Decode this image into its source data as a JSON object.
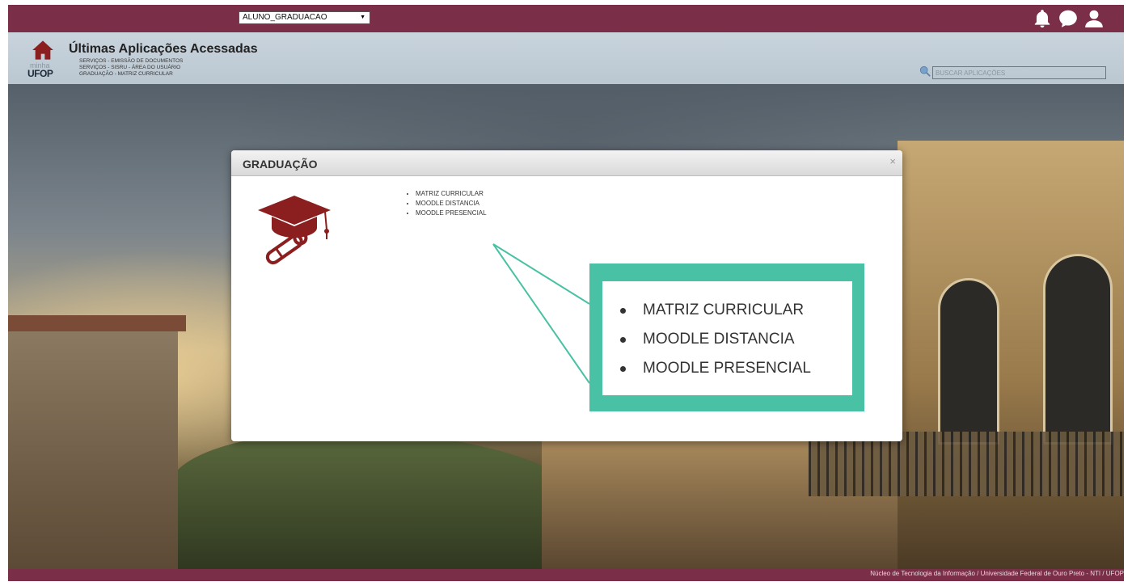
{
  "topbar": {
    "profile_select": {
      "selected": "ALUNO_GRADUACAO",
      "caret": "▼"
    },
    "icons": [
      "bell-icon",
      "chat-icon",
      "user-icon"
    ]
  },
  "header": {
    "logo_sub": "minha",
    "logo_brand": "UFOP",
    "recent_title": "Últimas Aplicações Acessadas",
    "recent_items": [
      "SERVIÇOS - EMISSÃO DE DOCUMENTOS",
      "SERVIÇOS - SISRU - ÁREA DO USUÁRIO",
      "GRADUAÇÃO - MATRIZ CURRICULAR"
    ],
    "search_placeholder": "BUSCAR APLICAÇÕES"
  },
  "modal": {
    "title": "GRADUAÇÃO",
    "close": "×",
    "items": [
      "MATRIZ CURRICULAR",
      "MOODLE DISTANCIA",
      "MOODLE PRESENCIAL"
    ]
  },
  "callout": {
    "items": [
      "MATRIZ CURRICULAR",
      "MOODLE DISTANCIA",
      "MOODLE PRESENCIAL"
    ]
  },
  "footer": {
    "text": "Núcleo de Tecnologia da Informação / Universidade Federal de Ouro Preto - NTI / UFOP"
  },
  "colors": {
    "brand": "#7a2e48",
    "accent": "#49c1a4",
    "header_bg": "#c9d4dd",
    "icon_red": "#8b1f1f"
  }
}
